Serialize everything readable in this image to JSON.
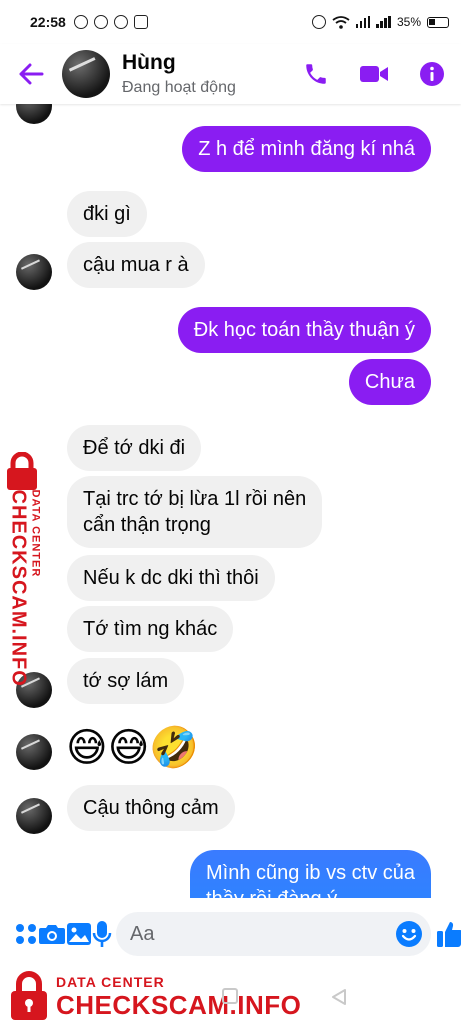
{
  "status_bar": {
    "time": "22:58",
    "battery": "35%"
  },
  "header": {
    "contact_name": "Hùng",
    "contact_status": "Đang hoạt động",
    "icons": [
      "back-arrow-icon",
      "phone-icon",
      "video-camera-icon",
      "info-icon"
    ],
    "accent_color": "#8a1df2"
  },
  "messages": [
    {
      "sender": "me",
      "text": "Z h để mình đăng kí nhá"
    },
    {
      "sender": "contact",
      "text": "đki gì"
    },
    {
      "sender": "contact",
      "text": "cậu mua r à"
    },
    {
      "sender": "me",
      "text": "Đk học toán thầy thuận ý"
    },
    {
      "sender": "me",
      "text": "Chưa"
    },
    {
      "sender": "contact",
      "text": "Để tớ dki đi"
    },
    {
      "sender": "contact",
      "text": "Tại trc tớ bị lừa 1l rồi nên\ncẩn thận trọng"
    },
    {
      "sender": "contact",
      "text": "Nếu k dc dki thì thôi"
    },
    {
      "sender": "contact",
      "text": "Tớ tìm ng khác"
    },
    {
      "sender": "contact",
      "text": "tớ sợ lám"
    },
    {
      "sender": "contact",
      "text": "😅😅🤣"
    },
    {
      "sender": "contact",
      "text": "Cậu thông cảm"
    },
    {
      "sender": "me",
      "text": "Mình cũng ib vs ctv của\nthầy rồi đàng ý"
    }
  ],
  "composer": {
    "placeholder": "Aa",
    "icons": [
      "menu-dots-icon",
      "camera-icon",
      "image-icon",
      "microphone-icon",
      "emoji-icon",
      "like-icon"
    ]
  },
  "watermark": {
    "title": "DATA CENTER",
    "url": "CHECKSCAM.INFO",
    "color": "#d6161e"
  }
}
